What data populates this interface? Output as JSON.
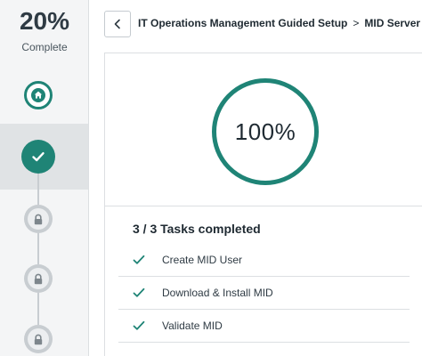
{
  "progress": {
    "percent": "20%",
    "label": "Complete"
  },
  "steps": [
    {
      "icon": "home-icon",
      "state": "done"
    },
    {
      "icon": "check-icon",
      "state": "active"
    },
    {
      "icon": "lock-icon",
      "state": "locked"
    },
    {
      "icon": "lock-icon",
      "state": "locked"
    },
    {
      "icon": "lock-icon",
      "state": "locked"
    }
  ],
  "header": {
    "back_icon": "chevron-left-icon",
    "breadcrumb_parent": "IT Operations Management Guided Setup",
    "breadcrumb_separator": ">",
    "breadcrumb_current": "MID Server"
  },
  "summary": {
    "percent": "100%"
  },
  "tasks": {
    "title": "3 / 3 Tasks completed",
    "items": [
      {
        "label": "Create MID User",
        "status": "completed"
      },
      {
        "label": "Download & Install MID",
        "status": "completed"
      },
      {
        "label": "Validate MID",
        "status": "completed"
      }
    ]
  },
  "colors": {
    "accent": "#1f8476",
    "locked": "#c8cdd1",
    "rail_bg": "#f4f5f6",
    "active_bg": "#e0e3e5"
  }
}
